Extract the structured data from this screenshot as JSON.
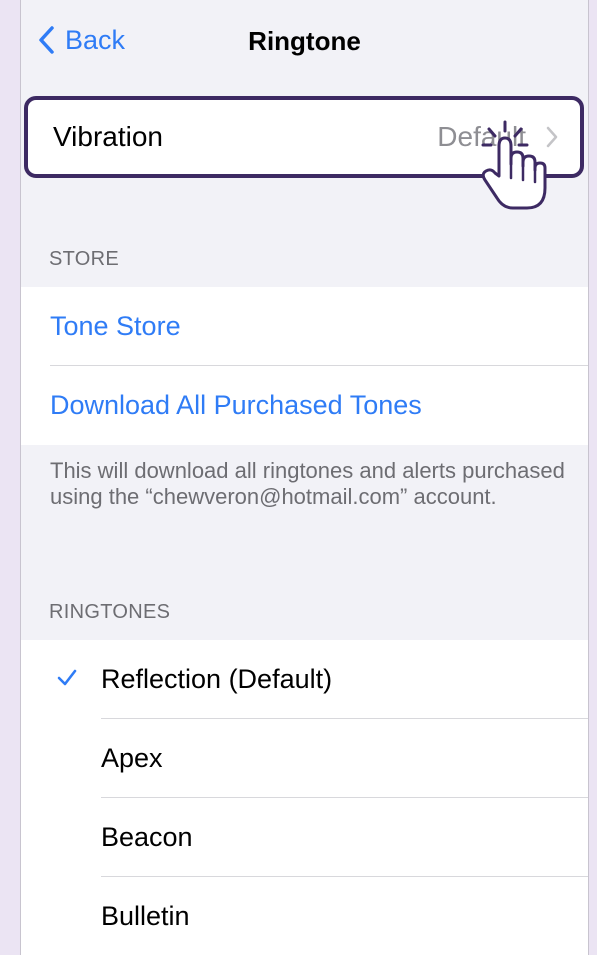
{
  "nav": {
    "back_label": "Back",
    "title": "Ringtone"
  },
  "vibration": {
    "label": "Vibration",
    "value": "Default"
  },
  "store": {
    "header": "STORE",
    "items": [
      {
        "label": "Tone Store"
      },
      {
        "label": "Download All Purchased Tones"
      }
    ],
    "footer": "This will download all ringtones and alerts purchased using the “chewveron@hotmail.com” account."
  },
  "ringtones": {
    "header": "RINGTONES",
    "items": [
      {
        "label": "Reflection (Default)",
        "selected": true
      },
      {
        "label": "Apex",
        "selected": false
      },
      {
        "label": "Beacon",
        "selected": false
      },
      {
        "label": "Bulletin",
        "selected": false
      }
    ]
  },
  "colors": {
    "accent": "#2f7cf6",
    "highlight_border": "#3d2a63",
    "background": "#f2f2f7",
    "frame": "#ebe4f3"
  },
  "icons": {
    "back": "chevron-left-icon",
    "disclosure": "chevron-right-icon",
    "checkmark": "checkmark-icon",
    "pointer": "hand-pointer-icon"
  }
}
